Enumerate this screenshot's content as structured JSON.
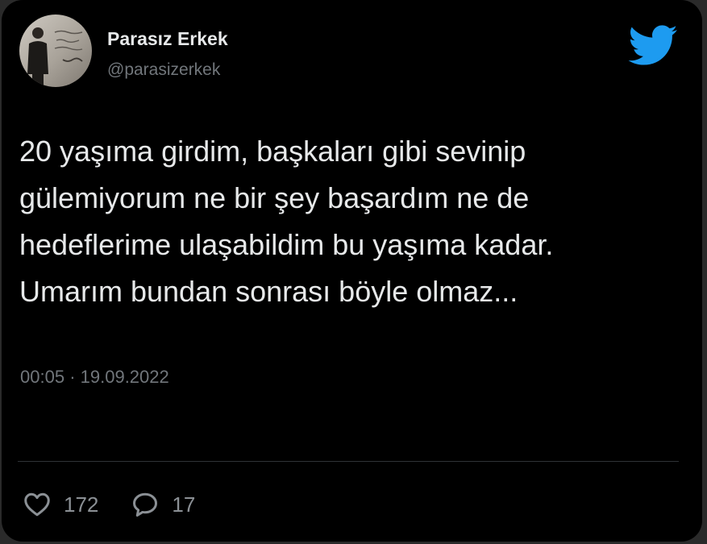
{
  "author": {
    "display_name": "Parasız Erkek",
    "handle": "@parasizerkek"
  },
  "brand": {
    "icon": "twitter-bird-icon",
    "color": "#1d9bf0"
  },
  "tweet": {
    "lines": [
      "20 yaşıma girdim, başkaları gibi sevinip",
      "gülemiyorum ne bir şey başardım ne de",
      "hedeflerime ulaşabildim bu yaşıma kadar.",
      "Umarım bundan sonrası böyle olmaz..."
    ],
    "time": "00:05",
    "separator": "·",
    "date": "19.09.2022"
  },
  "stats": {
    "likes": {
      "icon": "heart-icon",
      "count": "172"
    },
    "replies": {
      "icon": "speech-bubble-icon",
      "count": "17"
    }
  },
  "colors": {
    "background": "#000000",
    "primary_text": "#e7e9ea",
    "secondary_text": "#71767b"
  }
}
